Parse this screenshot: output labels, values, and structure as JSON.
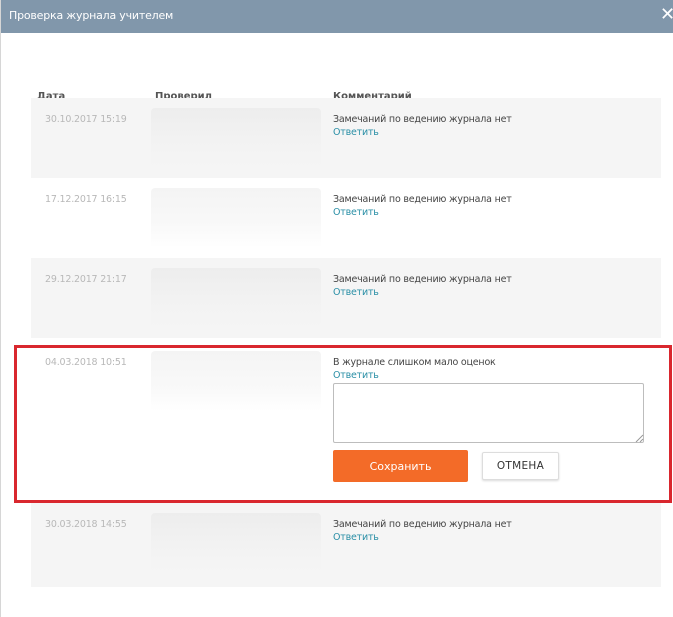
{
  "dialog": {
    "title": "Проверка журнала учителем",
    "close_glyph": "✕"
  },
  "columns": {
    "date": "Дата",
    "checker": "Проверил",
    "comment": "Комментарий"
  },
  "rows": [
    {
      "date": "30.10.2017 15:19",
      "comment": "Замечаний по ведению журнала нет",
      "reply": "Ответить"
    },
    {
      "date": "17.12.2017 16:15",
      "comment": "Замечаний по ведению журнала нет",
      "reply": "Ответить"
    },
    {
      "date": "29.12.2017 21:17",
      "comment": "Замечаний по ведению журнала нет",
      "reply": "Ответить"
    },
    {
      "date": "04.03.2018 10:51",
      "comment": "В журнале слишком мало оценок",
      "reply": "Ответить"
    },
    {
      "date": "30.03.2018 14:55",
      "comment": "Замечаний по ведению журнала нет",
      "reply": "Ответить"
    }
  ],
  "reply_form": {
    "save_label": "Сохранить",
    "cancel_label": "ОТМЕНА",
    "text": ""
  },
  "colors": {
    "titlebar": "#8197ab",
    "accent": "#f36b28",
    "link": "#2a8fa6",
    "highlight": "#d9272e",
    "row_bg": "#f5f5f5"
  }
}
